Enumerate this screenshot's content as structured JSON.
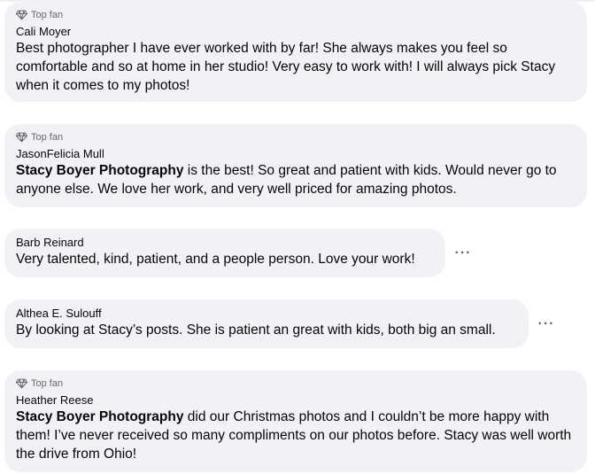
{
  "comments": [
    {
      "badge": "Top fan",
      "author": "Cali Moyer",
      "mention": "",
      "text": "Best photographer I have ever worked with by far! She always makes you feel so comfortable and so at home in her studio! Very easy to work with! I will always pick Stacy when it comes to my photos!"
    },
    {
      "badge": "Top fan",
      "author": "JasonFelicia Mull",
      "mention": "Stacy Boyer Photography",
      "text": " is the best! So great and patient with kids. Would never go to anyone else. We love her work, and very well priced for amazing photos."
    },
    {
      "badge": "",
      "author": "Barb Reinard",
      "mention": "",
      "text": "Very talented, kind, patient, and a people person. Love your work!",
      "more": "···"
    },
    {
      "badge": "",
      "author": "Althea E. Sulouff",
      "mention": "",
      "text": "By looking at Stacy’s posts. She is patient an great with kids, both big an small.",
      "more": "···"
    },
    {
      "badge": "Top fan",
      "author": "Heather Reese",
      "mention": "Stacy Boyer Photography",
      "text": " did our Christmas photos and I couldn’t be more happy with them! I’ve never received so many compliments on our photos before. Stacy was well worth the drive from Ohio!"
    }
  ]
}
